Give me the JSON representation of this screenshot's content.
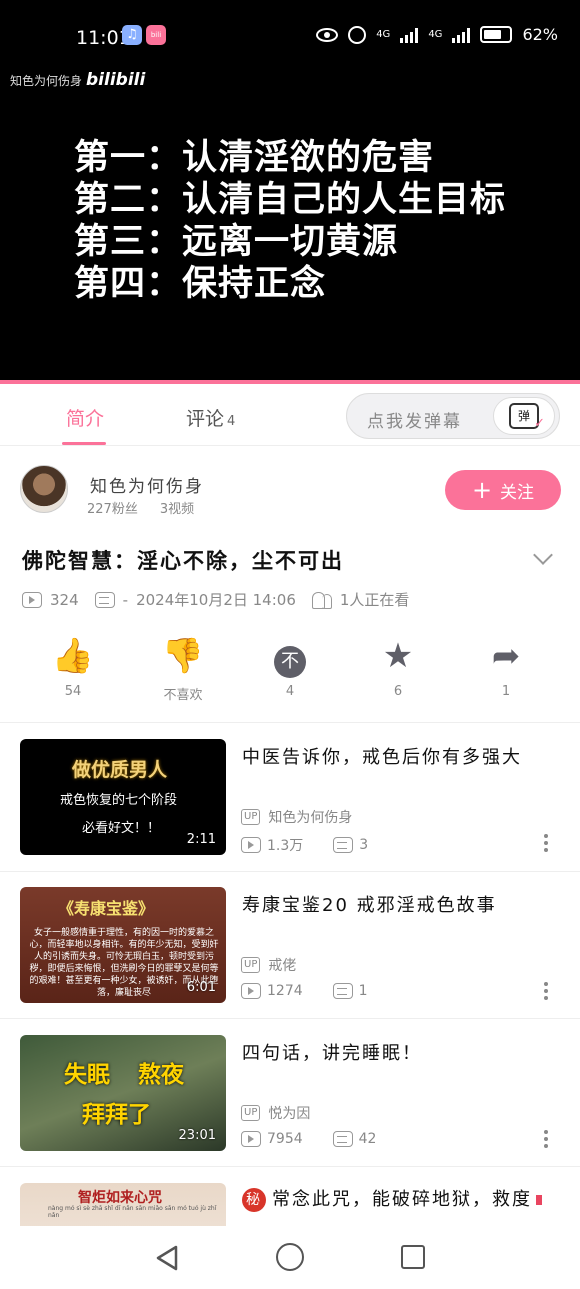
{
  "status_bar": {
    "time": "11:01",
    "net1": "4G",
    "net2": "4G",
    "battery": "62%"
  },
  "video": {
    "watermark_text": "知色为何伤身",
    "watermark_brand": "bilibili",
    "lines": [
      "第一：认清淫欲的危害",
      "第二：认清自己的人生目标",
      "第三：远离一切黄源",
      "第四：保持正念"
    ]
  },
  "tabs": {
    "intro": "简介",
    "comments": "评论",
    "comments_count": "4",
    "danmu_placeholder": "点我发弹幕",
    "danmu_button": "弹"
  },
  "uploader": {
    "name": "知色为何伤身",
    "fans": "227粉丝",
    "videos": "3视频",
    "follow_label": "关注"
  },
  "video_info": {
    "title": "佛陀智慧：淫心不除，尘不可出",
    "views": "324",
    "danmaku": "-",
    "date": "2024年10月2日 14:06",
    "watching": "1人正在看"
  },
  "actions": {
    "like": "54",
    "dislike": "不喜欢",
    "coin": "4",
    "fav": "6",
    "share": "1",
    "coin_glyph": "不"
  },
  "related": [
    {
      "title": "中医告诉你，戒色后你有多强大",
      "uploader": "知色为何伤身",
      "views": "1.3万",
      "comments": "3",
      "duration": "2:11",
      "thumb_head": "做优质男人",
      "thumb_line2": "戒色恢复的七个阶段",
      "thumb_line3": "必看好文！！"
    },
    {
      "title": "寿康宝鉴20 戒邪淫戒色故事",
      "uploader": "戒佬",
      "views": "1274",
      "comments": "1",
      "duration": "6:01",
      "thumb_head": "《寿康宝鉴》",
      "thumb_text": "女子一般感情重于理性，有的因一时的爱慕之心，而轻率地以身相许。有的年少无知，受到奸人的引诱而失身。可怜无瑕白玉，顿时受到污秽，即便后来悔恨，但洗刷今日的罪孽又是何等的艰难！甚至更有一种少女，被诱奸，而从此堕落，廉耻丧尽"
    },
    {
      "title": "四句话，讲完睡眠！",
      "uploader": "悦为因",
      "views": "7954",
      "comments": "42",
      "duration": "23:01",
      "thumb_a": "失眠",
      "thumb_b": "熬夜",
      "thumb_c": "拜拜了"
    },
    {
      "title": "常念此咒，能破碎地狱，救度",
      "badge": "秘",
      "thumb_head": "智炬如来心咒",
      "thumb_text": "nàng mó sì sè zhā shǐ dī nǎn sān miǎo sān mó tuó jù zhǐ nǎn"
    }
  ],
  "colors": {
    "accent": "#fb7299",
    "icon_gray": "#5f5f68"
  }
}
